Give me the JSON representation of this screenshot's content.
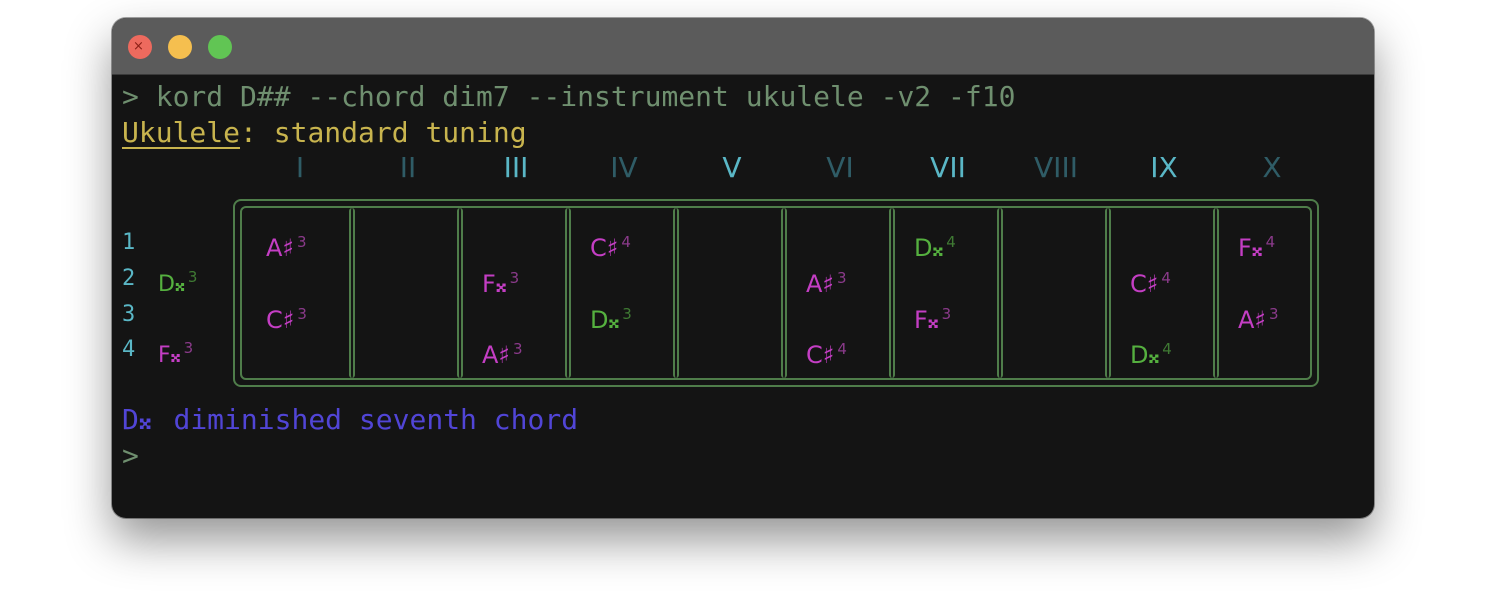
{
  "window": {
    "controls": [
      "close",
      "minimize",
      "maximize"
    ],
    "close_glyph": "×"
  },
  "terminal": {
    "command_line": "> kord D## --chord dim7 --instrument ukulele -v2 -f10",
    "instrument_name": "Ukulele",
    "tuning_suffix": ": standard tuning",
    "chord_root": "D𝄪",
    "chord_description": "diminished seventh chord",
    "prompt": ">"
  },
  "fretboard": {
    "fret_labels": [
      {
        "label": "I",
        "highlight": false
      },
      {
        "label": "II",
        "highlight": false
      },
      {
        "label": "III",
        "highlight": true
      },
      {
        "label": "IV",
        "highlight": false
      },
      {
        "label": "V",
        "highlight": true
      },
      {
        "label": "VI",
        "highlight": false
      },
      {
        "label": "VII",
        "highlight": true
      },
      {
        "label": "VIII",
        "highlight": false
      },
      {
        "label": "IX",
        "highlight": true
      },
      {
        "label": "X",
        "highlight": false
      }
    ],
    "strings": [
      {
        "number": "1",
        "open_note": "",
        "open_octave": ""
      },
      {
        "number": "2",
        "open_note": "D𝄪",
        "open_octave": "3"
      },
      {
        "number": "3",
        "open_note": "",
        "open_octave": ""
      },
      {
        "number": "4",
        "open_note": "F𝄪",
        "open_octave": "3"
      }
    ],
    "notes": [
      {
        "fret": 1,
        "string": 1,
        "name": "A♯",
        "octave": "3",
        "color": "magenta"
      },
      {
        "fret": 1,
        "string": 3,
        "name": "C♯",
        "octave": "3",
        "color": "magenta"
      },
      {
        "fret": 3,
        "string": 2,
        "name": "F𝄪",
        "octave": "3",
        "color": "magenta"
      },
      {
        "fret": 3,
        "string": 4,
        "name": "A♯",
        "octave": "3",
        "color": "magenta"
      },
      {
        "fret": 4,
        "string": 1,
        "name": "C♯",
        "octave": "4",
        "color": "magenta"
      },
      {
        "fret": 4,
        "string": 3,
        "name": "D𝄪",
        "octave": "3",
        "color": "green"
      },
      {
        "fret": 6,
        "string": 2,
        "name": "A♯",
        "octave": "3",
        "color": "magenta"
      },
      {
        "fret": 6,
        "string": 4,
        "name": "C♯",
        "octave": "4",
        "color": "magenta"
      },
      {
        "fret": 7,
        "string": 1,
        "name": "D𝄪",
        "octave": "4",
        "color": "green"
      },
      {
        "fret": 7,
        "string": 3,
        "name": "F𝄪",
        "octave": "3",
        "color": "magenta"
      },
      {
        "fret": 9,
        "string": 2,
        "name": "C♯",
        "octave": "4",
        "color": "magenta"
      },
      {
        "fret": 9,
        "string": 4,
        "name": "D𝄪",
        "octave": "4",
        "color": "green"
      },
      {
        "fret": 10,
        "string": 1,
        "name": "F𝄪",
        "octave": "4",
        "color": "magenta"
      },
      {
        "fret": 10,
        "string": 3,
        "name": "A♯",
        "octave": "3",
        "color": "magenta"
      }
    ]
  },
  "colors": {
    "background": "#141414",
    "titlebar": "#5b5b5b",
    "command": "#6f8f6f",
    "tuning": "#c8b44e",
    "summary": "#5145d6",
    "fret_label_highlight": "#5ab7c6",
    "fret_label_dim": "#2f5c66",
    "fretboard_lines": "#4f7d4a",
    "note_magenta": "#c43ec4",
    "note_green": "#55b03f"
  }
}
